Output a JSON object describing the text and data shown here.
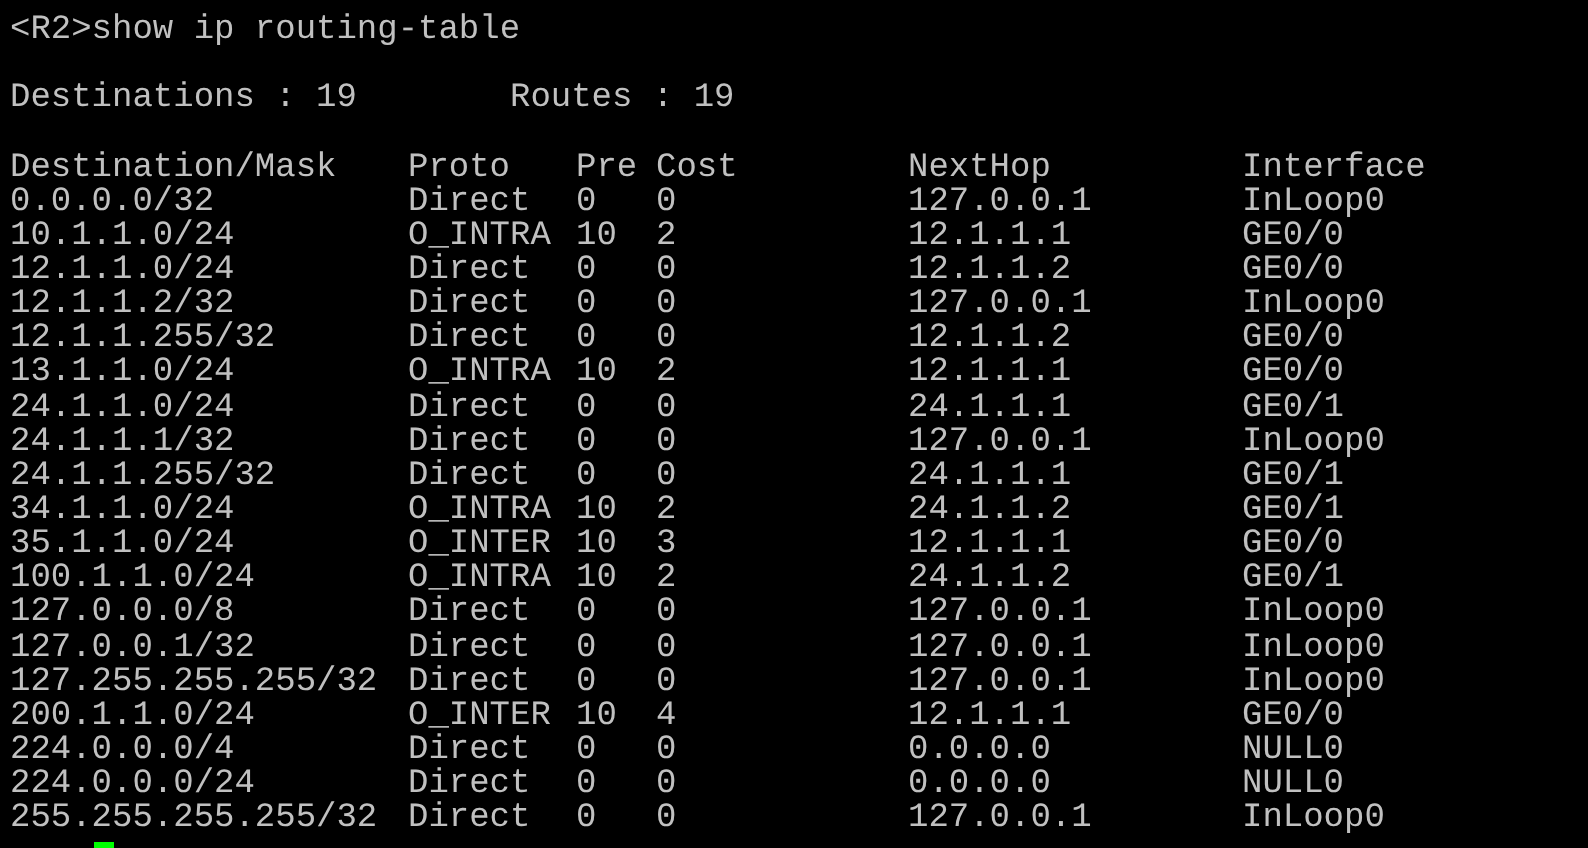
{
  "command": "<R2>show ip routing-table",
  "summary": {
    "destinations": "Destinations : 19",
    "routes": "Routes : 19"
  },
  "table": {
    "columns": [
      "Destination/Mask",
      "Proto",
      "Pre",
      "Cost",
      "NextHop",
      "Interface"
    ],
    "rows": [
      [
        "0.0.0.0/32",
        "Direct",
        "0",
        "0",
        "127.0.0.1",
        "InLoop0"
      ],
      [
        "10.1.1.0/24",
        "O_INTRA",
        "10",
        "2",
        "12.1.1.1",
        "GE0/0"
      ],
      [
        "12.1.1.0/24",
        "Direct",
        "0",
        "0",
        "12.1.1.2",
        "GE0/0"
      ],
      [
        "12.1.1.2/32",
        "Direct",
        "0",
        "0",
        "127.0.0.1",
        "InLoop0"
      ],
      [
        "12.1.1.255/32",
        "Direct",
        "0",
        "0",
        "12.1.1.2",
        "GE0/0"
      ],
      [
        "13.1.1.0/24",
        "O_INTRA",
        "10",
        "2",
        "12.1.1.1",
        "GE0/0"
      ],
      [
        "24.1.1.0/24",
        "Direct",
        "0",
        "0",
        "24.1.1.1",
        "GE0/1"
      ],
      [
        "24.1.1.1/32",
        "Direct",
        "0",
        "0",
        "127.0.0.1",
        "InLoop0"
      ],
      [
        "24.1.1.255/32",
        "Direct",
        "0",
        "0",
        "24.1.1.1",
        "GE0/1"
      ],
      [
        "34.1.1.0/24",
        "O_INTRA",
        "10",
        "2",
        "24.1.1.2",
        "GE0/1"
      ],
      [
        "35.1.1.0/24",
        "O_INTER",
        "10",
        "3",
        "12.1.1.1",
        "GE0/0"
      ],
      [
        "100.1.1.0/24",
        "O_INTRA",
        "10",
        "2",
        "24.1.1.2",
        "GE0/1"
      ],
      [
        "127.0.0.0/8",
        "Direct",
        "0",
        "0",
        "127.0.0.1",
        "InLoop0"
      ],
      [
        "127.0.0.1/32",
        "Direct",
        "0",
        "0",
        "127.0.0.1",
        "InLoop0"
      ],
      [
        "127.255.255.255/32",
        "Direct",
        "0",
        "0",
        "127.0.0.1",
        "InLoop0"
      ],
      [
        "200.1.1.0/24",
        "O_INTER",
        "10",
        "4",
        "12.1.1.1",
        "GE0/0"
      ],
      [
        "224.0.0.0/4",
        "Direct",
        "0",
        "0",
        "0.0.0.0",
        "NULL0"
      ],
      [
        "224.0.0.0/24",
        "Direct",
        "0",
        "0",
        "0.0.0.0",
        "NULL0"
      ],
      [
        "255.255.255.255/32",
        "Direct",
        "0",
        "0",
        "127.0.0.1",
        "InLoop0"
      ]
    ]
  }
}
